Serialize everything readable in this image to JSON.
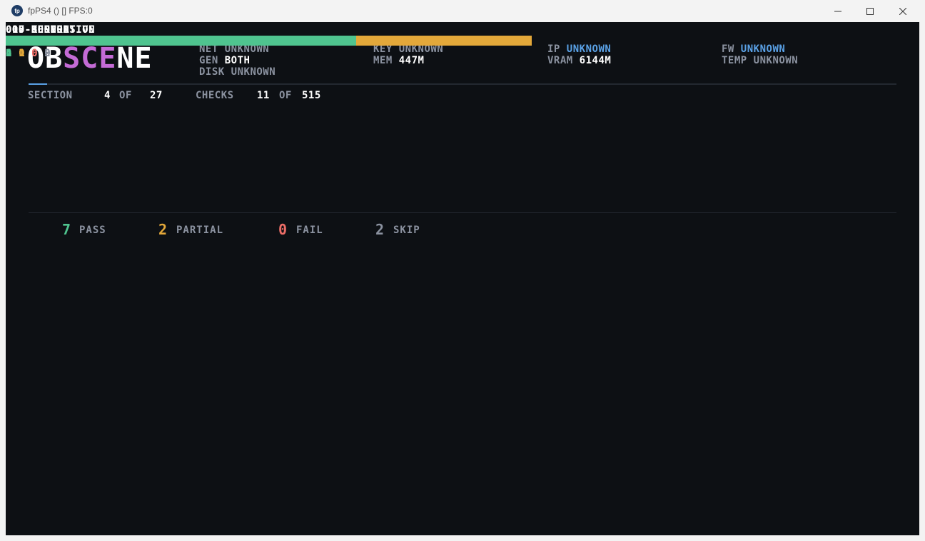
{
  "window": {
    "title": "fpPS4 () [] FPS:0",
    "icon_label": "fp"
  },
  "logo": {
    "part1": "OB",
    "part2": "SCE",
    "part3": "NE"
  },
  "info": {
    "net": {
      "key": "NET",
      "value": "UNKNOWN"
    },
    "gen": {
      "key": "GEN",
      "value": "BOTH"
    },
    "disk": {
      "key": "DISK",
      "value": "UNKNOWN"
    },
    "key": {
      "key": "KEY",
      "value": "UNKNOWN"
    },
    "mem": {
      "key": "MEM",
      "value": "447M"
    },
    "ip": {
      "key": "IP",
      "value": "UNKNOWN"
    },
    "vram": {
      "key": "VRAM",
      "value": "6144M"
    },
    "fw": {
      "key": "FW",
      "value": "UNKNOWN"
    },
    "temp": {
      "key": "TEMP",
      "value": "UNKNOWN"
    }
  },
  "progress": {
    "section_label": "SECTION",
    "section_current": "4",
    "of1": "OF",
    "section_total": "27",
    "checks_label": "CHECKS",
    "checks_current": "11",
    "of2": "OF",
    "checks_total": "515"
  },
  "colors": {
    "pass": "#4fc48f",
    "partial": "#e3a83a",
    "fail": "#ec6d67",
    "skip": "#6b7280"
  },
  "tests": [
    {
      "name": "000-BOOT",
      "pass": "4",
      "partial": "0",
      "fail": "0",
      "skip": "0"
    },
    {
      "name": "005-GENERATION",
      "pass": "1",
      "partial": "1",
      "fail": "0",
      "skip": "0"
    },
    {
      "name": "007-RESPONSIVE",
      "pass": "0",
      "partial": "0",
      "fail": "0",
      "skip": "2"
    },
    {
      "name": "010-KERNEL",
      "pass": "2",
      "partial": "1",
      "fail": "0",
      "skip": "0"
    }
  ],
  "summary": {
    "pass": {
      "count": "7",
      "label": "PASS"
    },
    "partial": {
      "count": "2",
      "label": "PARTIAL"
    },
    "fail": {
      "count": "0",
      "label": "FAIL"
    },
    "skip": {
      "count": "2",
      "label": "SKIP"
    }
  }
}
